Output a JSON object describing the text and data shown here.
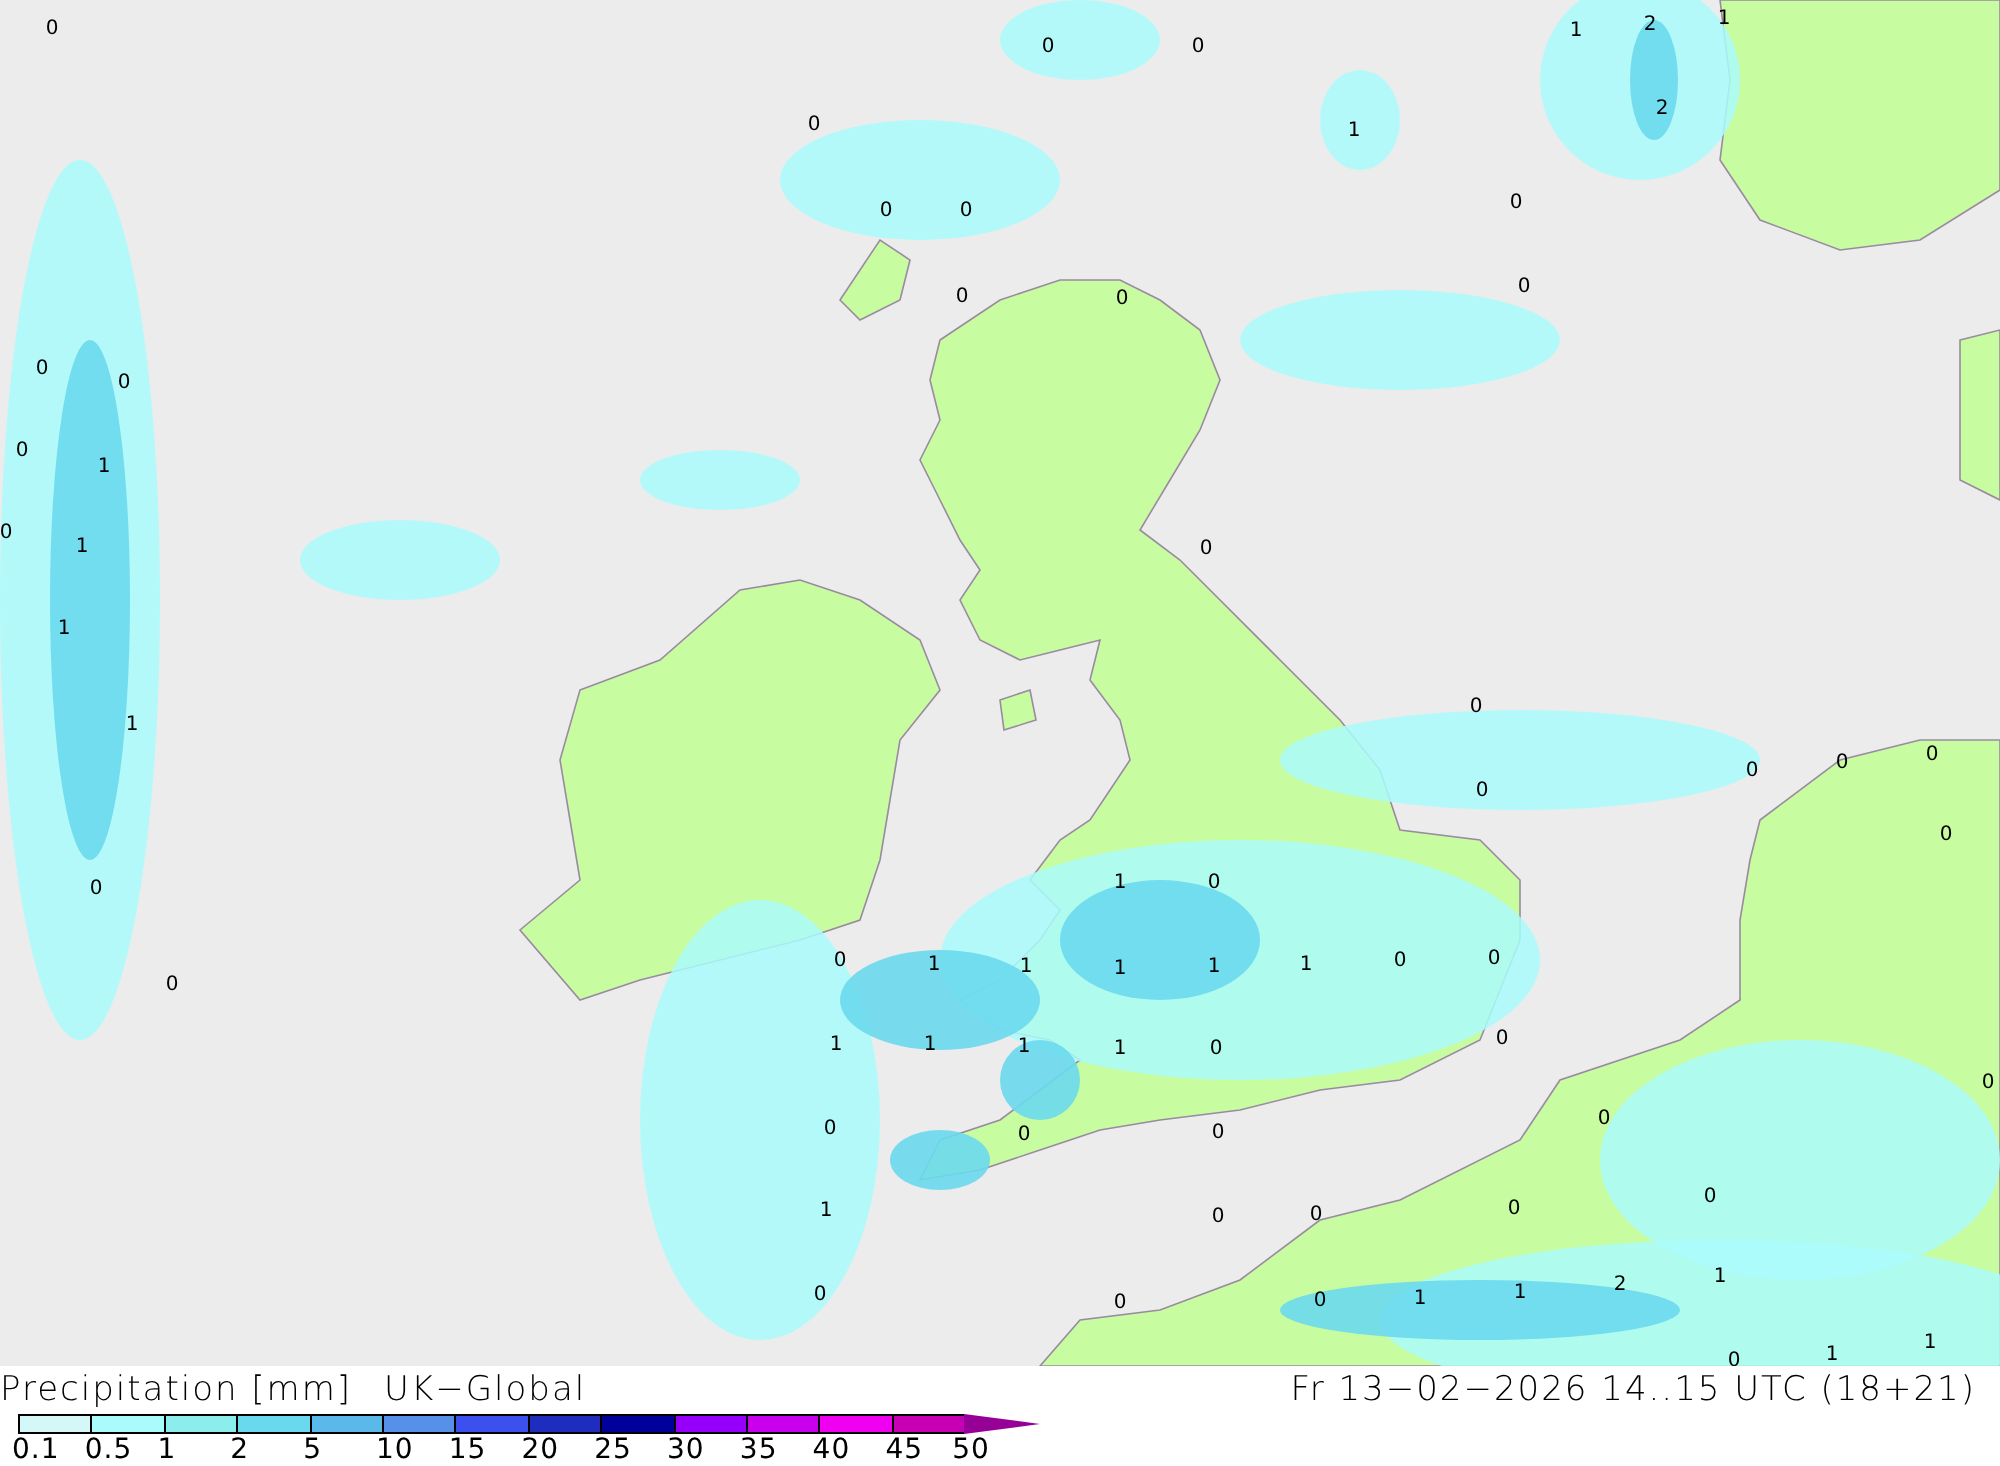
{
  "map": {
    "value_labels": [
      "0",
      "0",
      "0",
      "1",
      "2",
      "1",
      "1",
      "2",
      "0",
      "0",
      "0",
      "0",
      "0",
      "0",
      "0",
      "0",
      "0",
      "0",
      "1",
      "0",
      "1",
      "0",
      "1",
      "1",
      "0",
      "0",
      "0",
      "0",
      "0",
      "0",
      "0",
      "1",
      "0",
      "0",
      "0",
      "1",
      "1",
      "1",
      "1",
      "1",
      "0",
      "0",
      "1",
      "1",
      "1",
      "1",
      "0",
      "0",
      "0",
      "0",
      "0",
      "0",
      "0",
      "1",
      "0",
      "0",
      "0",
      "0",
      "0",
      "0",
      "0",
      "1",
      "1",
      "2",
      "1",
      "1",
      "1",
      "0"
    ]
  },
  "legend": {
    "title": "Precipitation [mm]",
    "model": "UK−Global",
    "valid_time": "Fr 13−02−2026 14..15 UTC (18+21)",
    "bins": [
      {
        "label": "0.1",
        "color": "#d4f7f7"
      },
      {
        "label": "0.5",
        "color": "#aafcfc"
      },
      {
        "label": "1",
        "color": "#8ceded"
      },
      {
        "label": "2",
        "color": "#6ad9ed"
      },
      {
        "label": "5",
        "color": "#5ab9e8"
      },
      {
        "label": "10",
        "color": "#5591e8"
      },
      {
        "label": "15",
        "color": "#3c50f0"
      },
      {
        "label": "20",
        "color": "#1e2dbe"
      },
      {
        "label": "25",
        "color": "#00009b"
      },
      {
        "label": "30",
        "color": "#9600fa"
      },
      {
        "label": "35",
        "color": "#c800eb"
      },
      {
        "label": "40",
        "color": "#f000f0"
      },
      {
        "label": "45",
        "color": "#c800b4"
      }
    ],
    "max_label": "50"
  }
}
